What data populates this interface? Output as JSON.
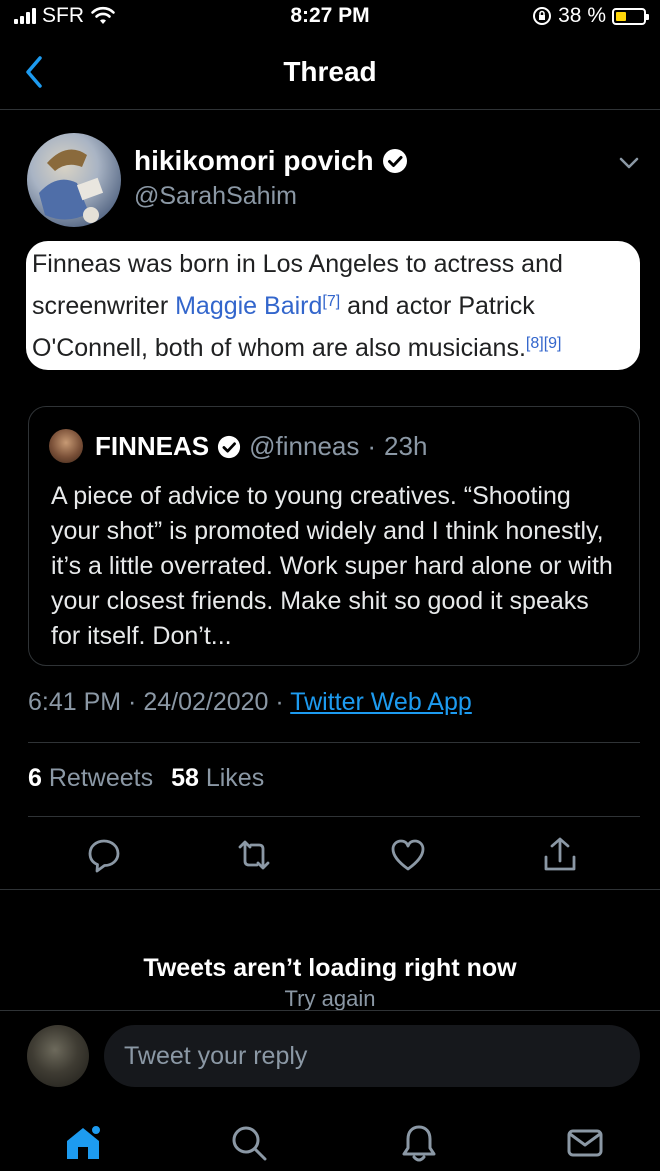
{
  "status_bar": {
    "carrier": "SFR",
    "time": "8:27 PM",
    "battery_percent": "38 %"
  },
  "nav": {
    "title": "Thread",
    "back_icon": "chevron-left-icon"
  },
  "tweet": {
    "author_name": "hikikomori povich",
    "author_handle": "@SarahSahim",
    "image_text": {
      "seg1": "Finneas was born in Los Angeles to actress and screenwriter ",
      "link1": "Maggie Baird",
      "ref1": "[7]",
      "seg2": " and actor Patrick O'Connell, both of whom are also musicians.",
      "ref2": "[8][9]"
    },
    "quote": {
      "name": "FINNEAS",
      "handle": "@finneas",
      "age": "23h",
      "text": "A piece of advice to young creatives. “Shooting your shot” is promoted widely and I think honestly, it’s a little overrated. Work super hard alone or with your closest friends. Make shit so good it speaks for itself. Don’t..."
    },
    "timestamp": "6:41 PM · 24/02/2020 · ",
    "source": "Twitter Web App",
    "retweets_count": "6",
    "retweets_label": "Retweets",
    "likes_count": "58",
    "likes_label": "Likes"
  },
  "error": {
    "title": "Tweets aren’t loading right now",
    "retry": "Try again"
  },
  "reply": {
    "placeholder": "Tweet your reply"
  },
  "colors": {
    "accent": "#1d9bf0",
    "secondary_text": "#8b98a5",
    "battery": "#ffd60a"
  }
}
